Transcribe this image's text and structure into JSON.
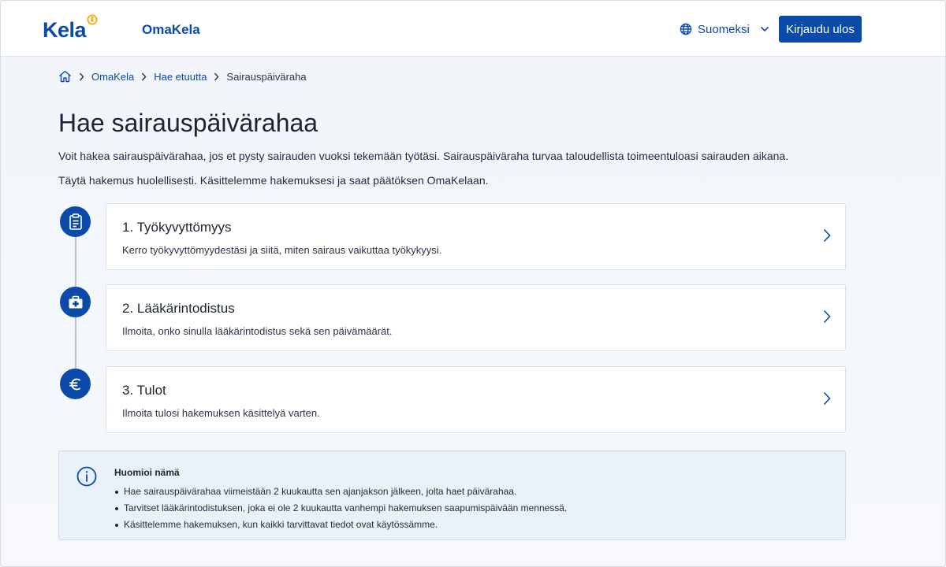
{
  "header": {
    "logo_text": "Kela",
    "app_name": "OmaKela",
    "language": "Suomeksi",
    "logout_label": "Kirjaudu ulos"
  },
  "breadcrumb": {
    "items": [
      "OmaKela",
      "Hae etuutta"
    ],
    "current": "Sairauspäiväraha"
  },
  "page": {
    "title": "Hae sairauspäivärahaa",
    "intro_1": "Voit hakea sairauspäivärahaa, jos et pysty sairauden vuoksi tekemään työtäsi. Sairauspäiväraha turvaa taloudellista toimeentuloasi sairauden aikana.",
    "intro_2": "Täytä hakemus huolellisesti. Käsittelemme hakemuksesi ja saat päätöksen OmaKelaan."
  },
  "steps": [
    {
      "title": "1. Työkyvyttömyys",
      "description": "Kerro työkyvyttömyydestäsi ja siitä, miten sairaus vaikuttaa työkykyysi.",
      "icon": "clipboard-icon"
    },
    {
      "title": "2. Lääkärintodistus",
      "description": "Ilmoita, onko sinulla lääkärintodistus sekä sen päivämäärät.",
      "icon": "medical-case-icon"
    },
    {
      "title": "3. Tulot",
      "description": "Ilmoita tulosi hakemuksen käsittelyä varten.",
      "icon": "euro-icon"
    }
  ],
  "notice": {
    "heading": "Huomioi nämä",
    "items": [
      "Hae sairauspäivärahaa viimeistään 2 kuukautta sen ajanjakson jälkeen, jolta haet päivärahaa.",
      "Tarvitset lääkärintodistuksen, joka ei ole 2 kuukautta vanhempi hakemuksen saapumispäivään mennessä.",
      "Käsittelemme hakemuksen, kun kaikki tarvittavat tiedot ovat käytössämme."
    ]
  },
  "colors": {
    "brand_blue": "#0b4aa8",
    "accent_yellow": "#f3b41b",
    "page_background": "#f1f5fa",
    "notice_background": "#e9f0f8"
  }
}
